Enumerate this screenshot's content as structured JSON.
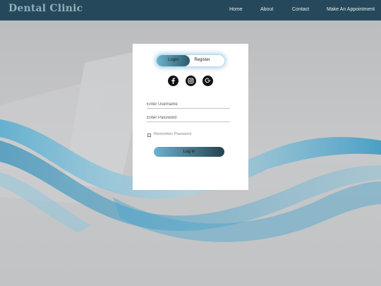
{
  "brand": {
    "name": "Dental Clinic"
  },
  "nav": {
    "items": [
      {
        "label": "Home"
      },
      {
        "label": "About"
      },
      {
        "label": "Contact"
      },
      {
        "label": "Make An Appointment"
      }
    ]
  },
  "auth": {
    "tabs": {
      "login": "Login",
      "register": "Register"
    },
    "active_tab": "Login",
    "social_icons": [
      "facebook-icon",
      "instagram-icon",
      "google-plus-icon"
    ],
    "username": {
      "placeholder": "Enter Username",
      "value": ""
    },
    "password": {
      "placeholder": "Enter Password",
      "value": ""
    },
    "remember_label": "Remember Password",
    "remember_checked": false,
    "submit_label": "Log in"
  },
  "colors": {
    "navbar": "#25495a",
    "brand": "#92aeba",
    "accent_start": "#6ab3cf",
    "accent_end": "#24424f",
    "background": "#c4c5c6"
  }
}
